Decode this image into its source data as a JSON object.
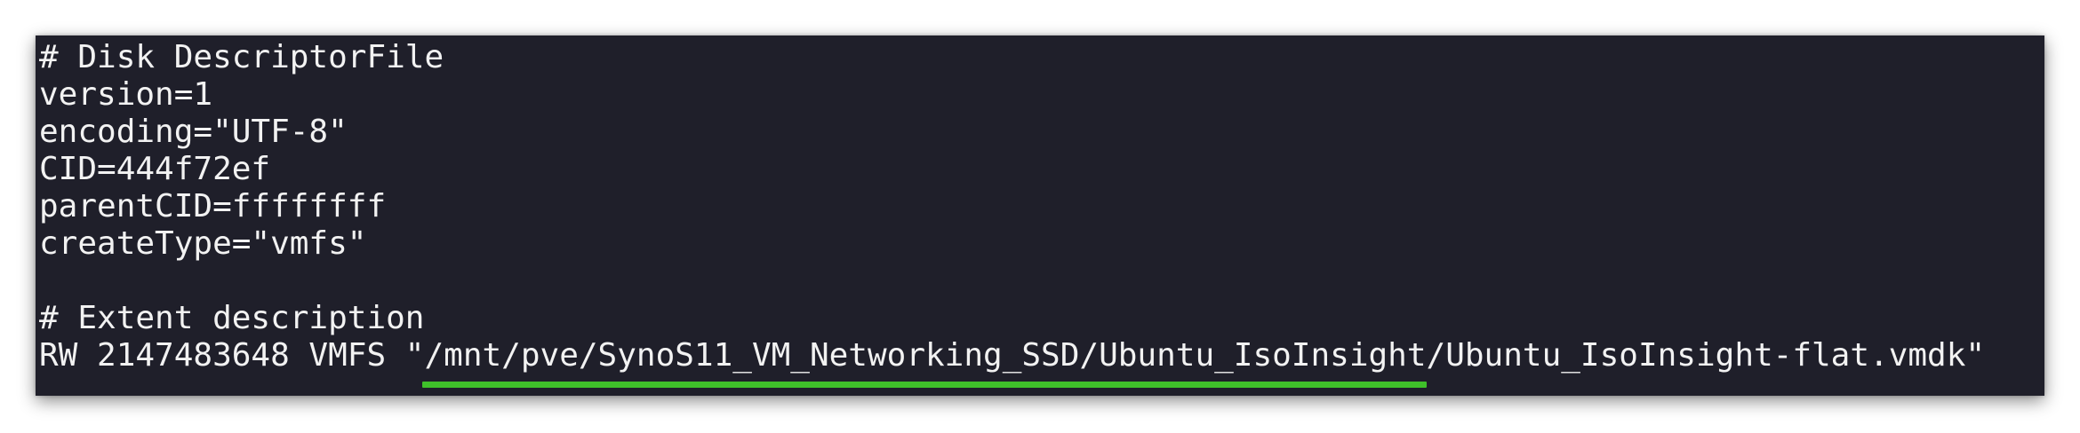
{
  "terminal": {
    "lines": {
      "l0": "# Disk DescriptorFile",
      "l1": "version=1",
      "l2": "encoding=\"UTF-8\"",
      "l3": "CID=444f72ef",
      "l4": "parentCID=ffffffff",
      "l5": "createType=\"vmfs\"",
      "l6": "",
      "l7": "# Extent description",
      "l8_prefix": "RW 2147483648 VMFS \"",
      "l8_path": "/mnt/pve/SynoS11_VM_Networking_SSD/Ubuntu_IsoInsight",
      "l8_suffix": "/Ubuntu_IsoInsight-flat.vmdk\""
    }
  },
  "colors": {
    "background": "#1f1f2a",
    "text": "#f2f2f2",
    "highlight_underline": "#3fc12a"
  }
}
